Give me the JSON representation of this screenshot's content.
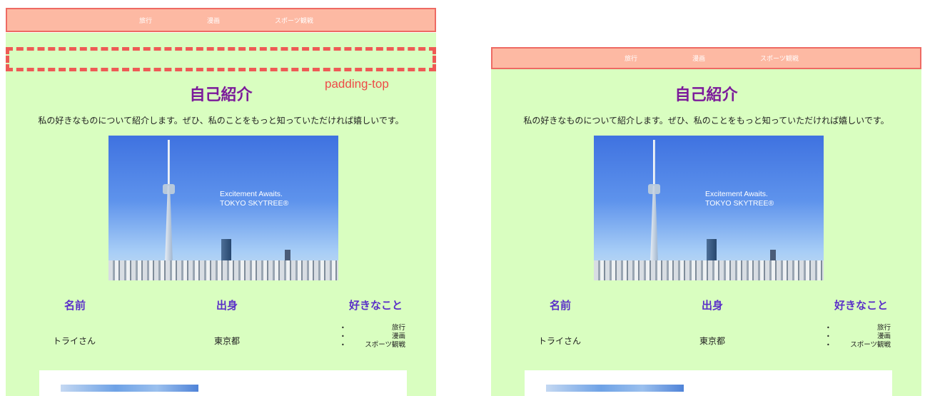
{
  "nav": {
    "items": [
      "旅行",
      "漫画",
      "スポーツ観戦"
    ]
  },
  "annotation": {
    "padding_label": "padding-top"
  },
  "page": {
    "title": "自己紹介",
    "intro": "私の好きなものについて紹介します。ぜひ、私のことをもっと知っていただければ嬉しいです。",
    "photo_text_line1": "Excitement Awaits.",
    "photo_text_line2": "TOKYO SKYTREE®"
  },
  "profile": {
    "headers": {
      "name": "名前",
      "origin": "出身",
      "likes": "好きなこと"
    },
    "name": "トライさん",
    "origin": "東京都",
    "likes": [
      "旅行",
      "漫画",
      "スポーツ観戦"
    ]
  },
  "colors": {
    "nav_bg": "#fdb9a3",
    "nav_border": "#ee6a63",
    "page_bg": "#d9fec0",
    "title": "#7b1a9a",
    "header": "#5a2fc8",
    "annotation": "#ee4a47"
  }
}
